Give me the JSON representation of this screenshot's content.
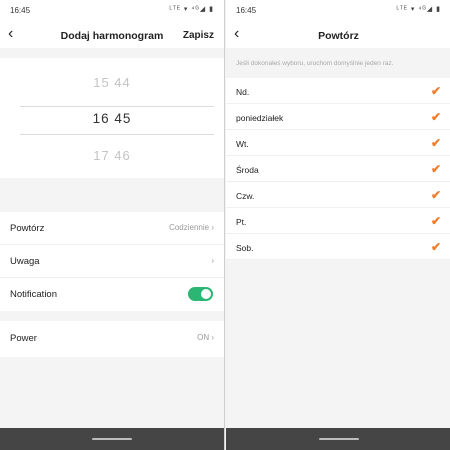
{
  "left": {
    "status": {
      "time": "16:45",
      "icons": "ᴸᵀᴱ ▾ ⁴ᴳ◢ ▮"
    },
    "header": {
      "back": "‹",
      "title": "Dodaj harmonogram",
      "save": "Zapisz"
    },
    "picker": {
      "prev": "15  44",
      "selected": "16  45",
      "next": "17  46"
    },
    "settings": [
      {
        "label": "Powtórz",
        "value": "Codziennie ›"
      },
      {
        "label": "Uwaga",
        "value": "›"
      },
      {
        "label": "Notification",
        "value": ""
      }
    ],
    "notification_on": true,
    "power": {
      "label": "Power",
      "value": "ON ›"
    }
  },
  "right": {
    "status": {
      "time": "16:45",
      "icons": "ᴸᵀᴱ ▾ ⁴ᴳ◢ ▮"
    },
    "header": {
      "back": "‹",
      "title": "Powtórz"
    },
    "hint": "Jeśli dokonałeś wyboru, uruchom domyślnie jeden raz.",
    "days": [
      "Nd.",
      "poniedziałek",
      "Wt.",
      "Środa",
      "Czw.",
      "Pt.",
      "Sob."
    ],
    "check": "✔",
    "accent": "#f07d2b"
  }
}
